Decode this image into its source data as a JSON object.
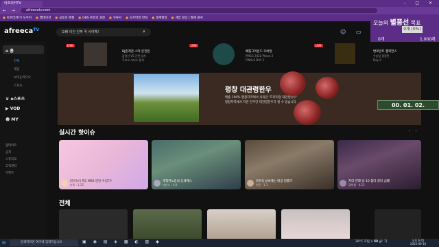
{
  "browser": {
    "tab_title": "아프리카TV",
    "url": "afreecatv.com",
    "nav_icons": "← → ⟳",
    "window_controls": "– ▢ ✕",
    "bookmarks": [
      "아프리카TV 도우미",
      "멜데이션",
      "공동의 메칠",
      "OBS 로봇의 설정",
      "유튜브",
      "도트머킹 완성",
      "생계할일",
      "게임 정상 | 웹게 원서"
    ]
  },
  "overlay": {
    "title_prefix": "오늘의",
    "title_highlight": "별풍선",
    "title_suffix": "목표",
    "box_value": "0개 (0%)",
    "left_value": "0개",
    "right_value": "1,000개"
  },
  "header": {
    "logo": "afreeca",
    "logo_suffix": "TV",
    "search_placeholder": "오빠 이건 진짜 꼭 사야해!",
    "search_icon": "⌕",
    "icons": "☺ ▭ ▢ ♥"
  },
  "sidebar": {
    "items": [
      {
        "label": "홈",
        "type": "main",
        "icon": "home-icon"
      },
      {
        "label": "전체",
        "type": "sub"
      },
      {
        "label": "게임",
        "type": "sub"
      },
      {
        "label": "보이는라디오",
        "type": "sub"
      },
      {
        "label": "스포츠",
        "type": "sub"
      },
      {
        "label": "e스포츠",
        "type": "main",
        "icon": "trophy-icon"
      },
      {
        "label": "VOD",
        "type": "main",
        "icon": "play-icon"
      },
      {
        "label": "MY",
        "type": "main",
        "icon": "user-icon"
      },
      {
        "label": "업데이트",
        "type": "sub"
      },
      {
        "label": "공지",
        "type": "sub"
      },
      {
        "label": "스튜디오",
        "type": "sub"
      },
      {
        "label": "고객센터",
        "type": "sub"
      },
      {
        "label": "이벤트",
        "type": "sub"
      }
    ]
  },
  "strip": [
    {
      "live": "LIVE",
      "title": "BJ준계관 스타 문전원",
      "sub1": "감정선 VS 간편 일차",
      "sub2": "주요고 서비스 통치"
    },
    {
      "live": "LIVE",
      "title": "배틀그라운드 모바일",
      "sub1": "PMGC 2022 Phase 2",
      "sub2": "FINALS DAY 3"
    },
    {
      "live": "LIVE",
      "title": "발로란트 챔피언스",
      "sub1": "우승팀 결정전",
      "sub2": "Day 2"
    }
  ],
  "banner": {
    "title": "평창 대관령한우",
    "desc1": "매출 100% 평창지역에서 사육한 '프리미엄 대관령한우'",
    "desc2": "평창지역에서 자란 한우만 대관령한우가 될 수 있습니다",
    "timer": "00. 01. 02."
  },
  "hot": {
    "title": "실시간 핫이슈",
    "arrows": "‹ ›",
    "cards": [
      {
        "title": "[라이브] 제1 MBS 당당 수집가!",
        "meta": "부족 · 1.25"
      },
      {
        "title": "개척현노동의 신세계스",
        "meta": "대한노 · 4.8"
      },
      {
        "title": "[이이] 날씨에는 대공 당했기",
        "meta": "이민 · 1.1"
      },
      {
        "title": "자리 전화 날 10 점다 알다 심폐",
        "meta": "감착원 · 4.11"
      }
    ]
  },
  "all": {
    "title": "전체"
  },
  "taskbar": {
    "start": "⊞",
    "search": "검색하려면 여기에 입력하십시오",
    "icons": "▣ ◉ ▤ ◈ ▦ ◐ ▧ ◆",
    "weather": "28°C 흐림",
    "tray": "∧ ⌨ 🔊 가",
    "time": "오후 6:45",
    "date": "2022-09-16"
  },
  "colors": {
    "brand": "#5b2d86",
    "live": "#e0262b",
    "accent": "#3aa0ff"
  }
}
